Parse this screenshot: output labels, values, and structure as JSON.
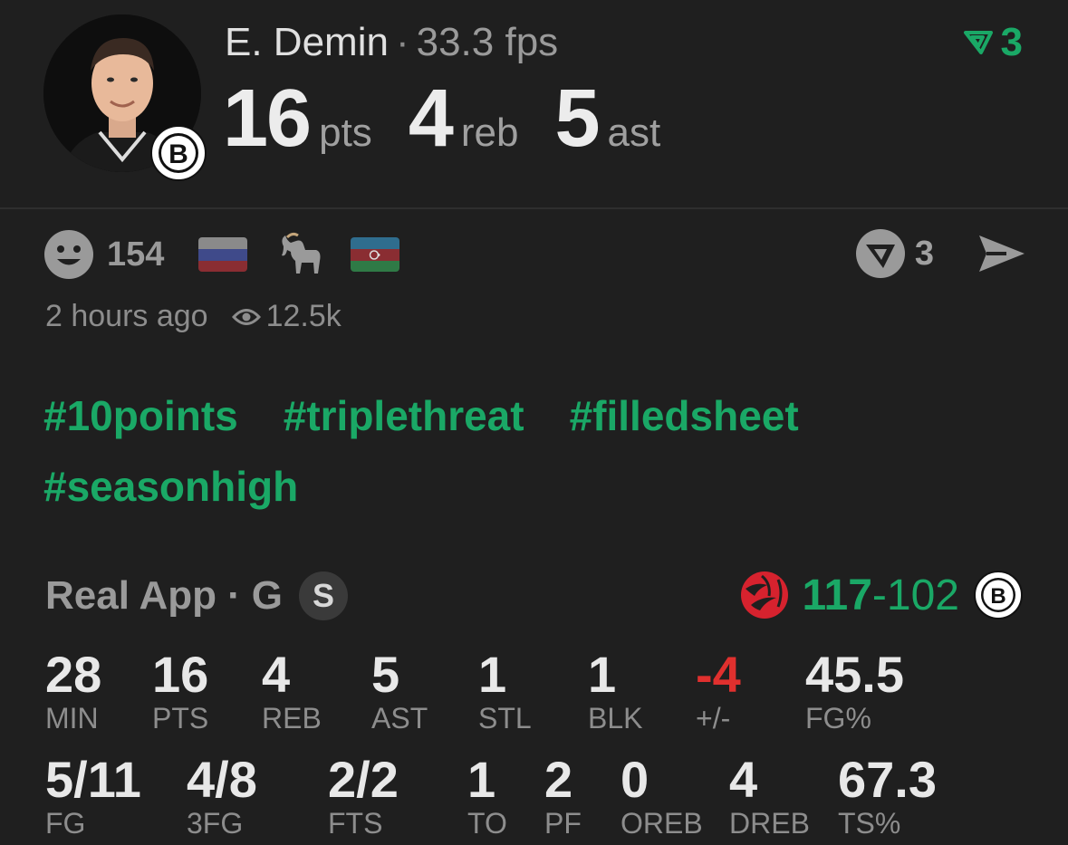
{
  "player": {
    "name": "E. Demin",
    "fps": "33.3 fps",
    "team_logo_letter": "B",
    "stats": [
      {
        "value": "16",
        "unit": "pts"
      },
      {
        "value": "4",
        "unit": "reb"
      },
      {
        "value": "5",
        "unit": "ast"
      }
    ]
  },
  "vote_top_count": "3",
  "reactions": {
    "count": "154",
    "right_count": "3"
  },
  "meta": {
    "time": "2 hours ago",
    "views": "12.5k"
  },
  "tags": [
    "#10points",
    "#triplethreat",
    "#filledsheet",
    "#seasonhigh"
  ],
  "game": {
    "source": "Real App",
    "position": "G",
    "badge": "S",
    "score_home": "117",
    "score_away": "102"
  },
  "box_row1": [
    {
      "value": "28",
      "label": "MIN"
    },
    {
      "value": "16",
      "label": "PTS"
    },
    {
      "value": "4",
      "label": "REB"
    },
    {
      "value": "5",
      "label": "AST"
    },
    {
      "value": "1",
      "label": "STL"
    },
    {
      "value": "1",
      "label": "BLK"
    },
    {
      "value": "-4",
      "label": "+/-"
    },
    {
      "value": "45.5",
      "label": "FG%"
    }
  ],
  "box_row2": [
    {
      "value": "5/11",
      "label": "FG"
    },
    {
      "value": "4/8",
      "label": "3FG"
    },
    {
      "value": "2/2",
      "label": "FTS"
    },
    {
      "value": "1",
      "label": "TO"
    },
    {
      "value": "2",
      "label": "PF"
    },
    {
      "value": "0",
      "label": "OREB"
    },
    {
      "value": "4",
      "label": "DREB"
    },
    {
      "value": "67.3",
      "label": "TS%"
    }
  ],
  "colors": {
    "accent_green": "#1aa866",
    "negative_red": "#e0302e",
    "background": "#1f1f1f"
  }
}
